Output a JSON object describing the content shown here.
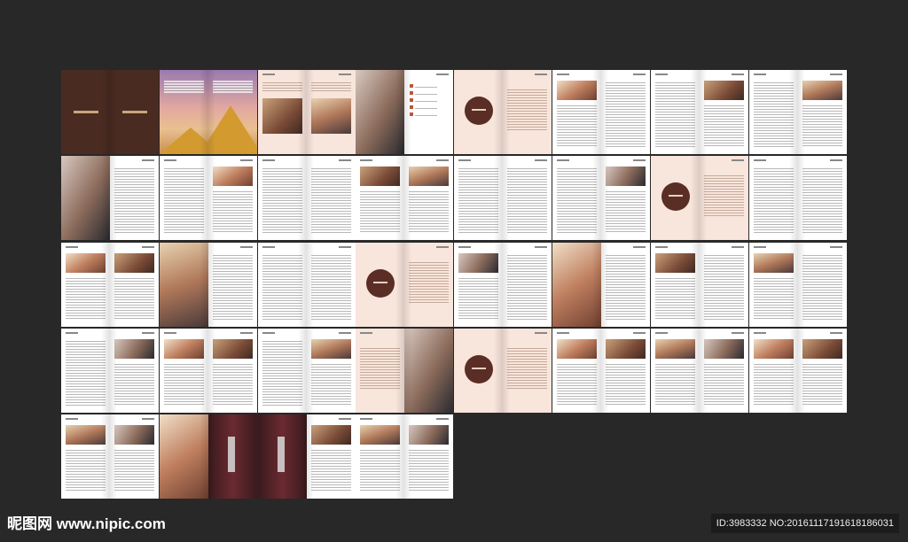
{
  "colors": {
    "background": "#282828",
    "brown": "#4a2b22",
    "pink": "#f8e5dc",
    "accent": "#b9583a",
    "circle": "#5a2e25"
  },
  "rows": [
    [
      [
        "brown",
        "brown"
      ],
      [
        "pyramid",
        "pyramid"
      ],
      [
        "pinkimg",
        "pinkimg"
      ],
      [
        "photo",
        "list"
      ],
      [
        "circle",
        "pink"
      ],
      [
        "textimg",
        "text"
      ],
      [
        "text",
        "textimg"
      ],
      [
        "text",
        "textimg"
      ]
    ],
    [
      [
        "photo",
        "text"
      ],
      [
        "text",
        "textimg"
      ],
      [
        "text",
        "text"
      ],
      [
        "textimg",
        "textimg"
      ],
      [
        "text",
        "text"
      ],
      [
        "text",
        "textimg"
      ],
      [
        "circle",
        "pink"
      ],
      [
        "text",
        "text"
      ]
    ],
    [
      [
        "textimg",
        "textimg"
      ],
      [
        "photo",
        "text"
      ],
      [
        "text",
        "text"
      ],
      [
        "circle",
        "pink"
      ],
      [
        "textimg",
        "text"
      ],
      [
        "photo",
        "text"
      ],
      [
        "textimg",
        "text"
      ],
      [
        "textimg",
        "text"
      ]
    ],
    [
      [
        "text",
        "textimg"
      ],
      [
        "textimg",
        "textimg"
      ],
      [
        "text",
        "textimg"
      ],
      [
        "pink",
        "photo"
      ],
      [
        "circle",
        "pink"
      ],
      [
        "textimg",
        "textimg"
      ],
      [
        "textimg",
        "textimg"
      ],
      [
        "textimg",
        "textimg"
      ]
    ],
    [
      [
        "textimg",
        "textimg"
      ],
      [
        "photo",
        "door"
      ],
      [
        "door",
        "textimg"
      ],
      [
        "textimg",
        "textimg"
      ]
    ]
  ],
  "watermark": {
    "site": "昵图网 www.nipic.com",
    "id": "ID:3983332 NO:20161117191618186031"
  }
}
